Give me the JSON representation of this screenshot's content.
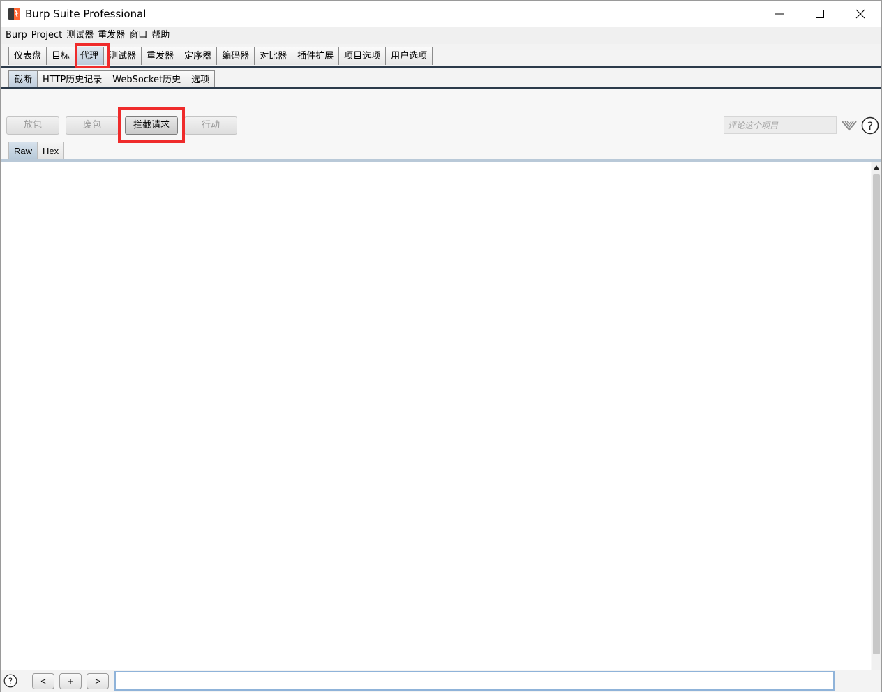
{
  "window": {
    "title": "Burp Suite Professional"
  },
  "menu": [
    "Burp",
    "Project",
    "测试器",
    "重发器",
    "窗口",
    "帮助"
  ],
  "main_tabs": [
    "仪表盘",
    "目标",
    "代理",
    "测试器",
    "重发器",
    "定序器",
    "编码器",
    "对比器",
    "插件扩展",
    "项目选项",
    "用户选项"
  ],
  "main_tab_selected": "代理",
  "sub_tabs": [
    "截断",
    "HTTP历史记录",
    "WebSocket历史",
    "选项"
  ],
  "sub_tab_selected": "截断",
  "toolbar": {
    "forward": "放包",
    "drop": "废包",
    "intercept": "拦截请求",
    "action": "行动",
    "comment_placeholder": "评论这个项目"
  },
  "view_tabs": [
    "Raw",
    "Hex"
  ],
  "view_tab_selected": "Raw",
  "bottom": {
    "prev": "<",
    "add": "+",
    "next": ">"
  },
  "colors": {
    "highlight": "#ef2b2b",
    "tab_line": "#2b3a4a",
    "selected_tab": "#bccbdb"
  }
}
